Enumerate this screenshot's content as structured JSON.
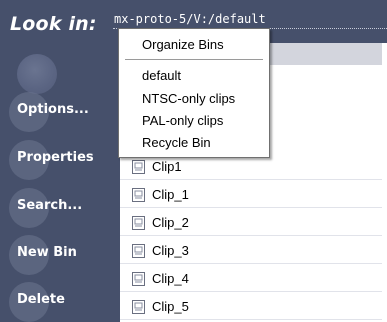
{
  "window": {
    "look_in_label": "Look in:",
    "path": "mx-proto-5/V:/default"
  },
  "sidebar": {
    "buttons": [
      {
        "label": "Options..."
      },
      {
        "label": "Properties"
      },
      {
        "label": "Search..."
      },
      {
        "label": "New Bin"
      },
      {
        "label": "Delete"
      }
    ]
  },
  "dropdown": {
    "items": [
      {
        "label": "Organize Bins"
      },
      {
        "label": "default"
      },
      {
        "label": "NTSC-only clips"
      },
      {
        "label": "PAL-only clips"
      },
      {
        "label": "Recycle Bin"
      }
    ]
  },
  "list": {
    "rows": [
      {
        "label": "Clip1"
      },
      {
        "label": "Clip_1"
      },
      {
        "label": "Clip_2"
      },
      {
        "label": "Clip_3"
      },
      {
        "label": "Clip_4"
      },
      {
        "label": "Clip_5"
      }
    ]
  },
  "colors": {
    "sidebar": "#46506b",
    "header": "#d3d5dd"
  }
}
